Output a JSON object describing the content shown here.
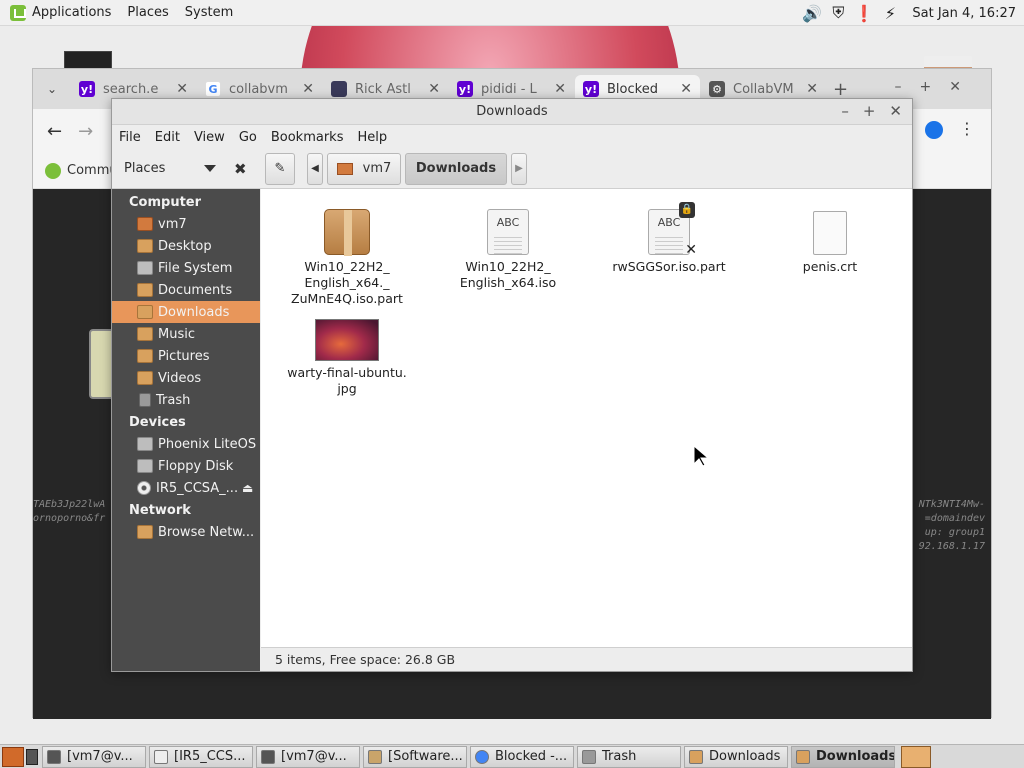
{
  "top_panel": {
    "menus": [
      "Applications",
      "Places",
      "System"
    ],
    "clock": "Sat Jan  4, 16:27"
  },
  "browser": {
    "tabs": [
      {
        "label": "search.e",
        "favicon": "yahoo-icon",
        "color": "#6001d2"
      },
      {
        "label": "collabvm",
        "favicon": "google-icon",
        "color": "#4285f4"
      },
      {
        "label": "Rick Astl",
        "favicon": "page-icon",
        "color": "#3a3a5a"
      },
      {
        "label": "pididi - L",
        "favicon": "yahoo-icon",
        "color": "#6001d2"
      },
      {
        "label": "Blocked",
        "favicon": "yahoo-icon",
        "color": "#6001d2"
      },
      {
        "label": "CollabVM",
        "favicon": "collabvm-icon",
        "color": "#555555"
      }
    ],
    "bookmark_label": "Commu",
    "bg_left_text": [
      "TAEb3Jp22lwA",
      "ornoporno&fr"
    ],
    "bg_right_text": [
      "NTk3NTI4Mw-",
      "=domaindev",
      "up: group1",
      "92.168.1.17"
    ]
  },
  "file_manager": {
    "title": "Downloads",
    "menu": [
      "File",
      "Edit",
      "View",
      "Go",
      "Bookmarks",
      "Help"
    ],
    "places_label": "Places",
    "path": [
      "vm7",
      "Downloads"
    ],
    "sidebar": [
      {
        "type": "head",
        "label": "Computer"
      },
      {
        "type": "item",
        "label": "vm7",
        "icon": "home-folder-icon"
      },
      {
        "type": "item",
        "label": "Desktop",
        "icon": "desktop-folder-icon"
      },
      {
        "type": "item",
        "label": "File System",
        "icon": "drive-icon"
      },
      {
        "type": "item",
        "label": "Documents",
        "icon": "documents-folder-icon"
      },
      {
        "type": "item",
        "label": "Downloads",
        "icon": "downloads-folder-icon",
        "selected": true
      },
      {
        "type": "item",
        "label": "Music",
        "icon": "music-folder-icon"
      },
      {
        "type": "item",
        "label": "Pictures",
        "icon": "pictures-folder-icon"
      },
      {
        "type": "item",
        "label": "Videos",
        "icon": "videos-folder-icon"
      },
      {
        "type": "item",
        "label": "Trash",
        "icon": "trash-icon"
      },
      {
        "type": "head",
        "label": "Devices"
      },
      {
        "type": "item",
        "label": "Phoenix LiteOS",
        "icon": "drive-icon"
      },
      {
        "type": "item",
        "label": "Floppy Disk",
        "icon": "floppy-icon"
      },
      {
        "type": "item",
        "label": "IR5_CCSA_...",
        "icon": "disc-icon",
        "eject": true
      },
      {
        "type": "head",
        "label": "Network"
      },
      {
        "type": "item",
        "label": "Browse Netw...",
        "icon": "network-icon"
      }
    ],
    "files": [
      {
        "name_lines": [
          "Win10_22H2_",
          "English_x64._",
          "ZuMnE4Q.iso.part"
        ],
        "icon": "archive-icon"
      },
      {
        "name_lines": [
          "Win10_22H2_",
          "English_x64.iso"
        ],
        "icon": "text-file-icon"
      },
      {
        "name_lines": [
          "rwSGGSor.iso.part"
        ],
        "icon": "locked-text-file-icon"
      },
      {
        "name_lines": [
          "penis.crt"
        ],
        "icon": "blank-file-icon"
      },
      {
        "name_lines": [
          "warty-final-ubuntu.",
          "jpg"
        ],
        "icon": "image-thumbnail-icon"
      }
    ],
    "status": "5 items, Free space: 26.8 GB"
  },
  "taskbar": {
    "items": [
      {
        "label": "[vm7@v...",
        "icon": "terminal-icon",
        "color": "#555555"
      },
      {
        "label": "[IR5_CCS...",
        "icon": "disc-icon",
        "color": "#eeeeee"
      },
      {
        "label": "[vm7@v...",
        "icon": "terminal-icon",
        "color": "#555555"
      },
      {
        "label": "[Software...",
        "icon": "package-icon",
        "color": "#c9a46a"
      },
      {
        "label": "Blocked -...",
        "icon": "chrome-icon",
        "color": "#4285f4"
      },
      {
        "label": "Trash",
        "icon": "trash-icon",
        "color": "#999999"
      },
      {
        "label": "Downloads",
        "icon": "folder-icon",
        "color": "#d8a15e"
      },
      {
        "label": "Downloads",
        "icon": "folder-icon",
        "color": "#d8a15e",
        "active": true
      }
    ]
  }
}
